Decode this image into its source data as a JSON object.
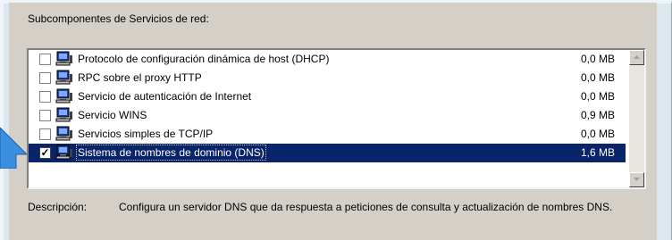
{
  "section": {
    "caption": "Subcomponentes de Servicios de red:"
  },
  "components": [
    {
      "label": "Protocolo de configuración dinámica de host (DHCP)",
      "size": "0,0 MB",
      "checked": false,
      "selected": false
    },
    {
      "label": "RPC sobre el proxy HTTP",
      "size": "0,0 MB",
      "checked": false,
      "selected": false
    },
    {
      "label": "Servicio de autenticación de Internet",
      "size": "0,0 MB",
      "checked": false,
      "selected": false
    },
    {
      "label": "Servicio WINS",
      "size": "0,9 MB",
      "checked": false,
      "selected": false
    },
    {
      "label": "Servicios simples de TCP/IP",
      "size": "0,0 MB",
      "checked": false,
      "selected": false
    },
    {
      "label": "Sistema de nombres de dominio (DNS)",
      "size": "1,6 MB",
      "checked": true,
      "selected": true
    }
  ],
  "description": {
    "label": "Descripción:",
    "text": "Configura un servidor DNS que da respuesta a peticiones de consulta y actualización de nombres DNS."
  },
  "icons": {
    "component": "network-computer-icon",
    "pointer": "blue-arrow-pointer-icon"
  },
  "colors": {
    "selection": "#0a246a",
    "dialog": "#d4d0c8",
    "background": "#dde8ee"
  }
}
